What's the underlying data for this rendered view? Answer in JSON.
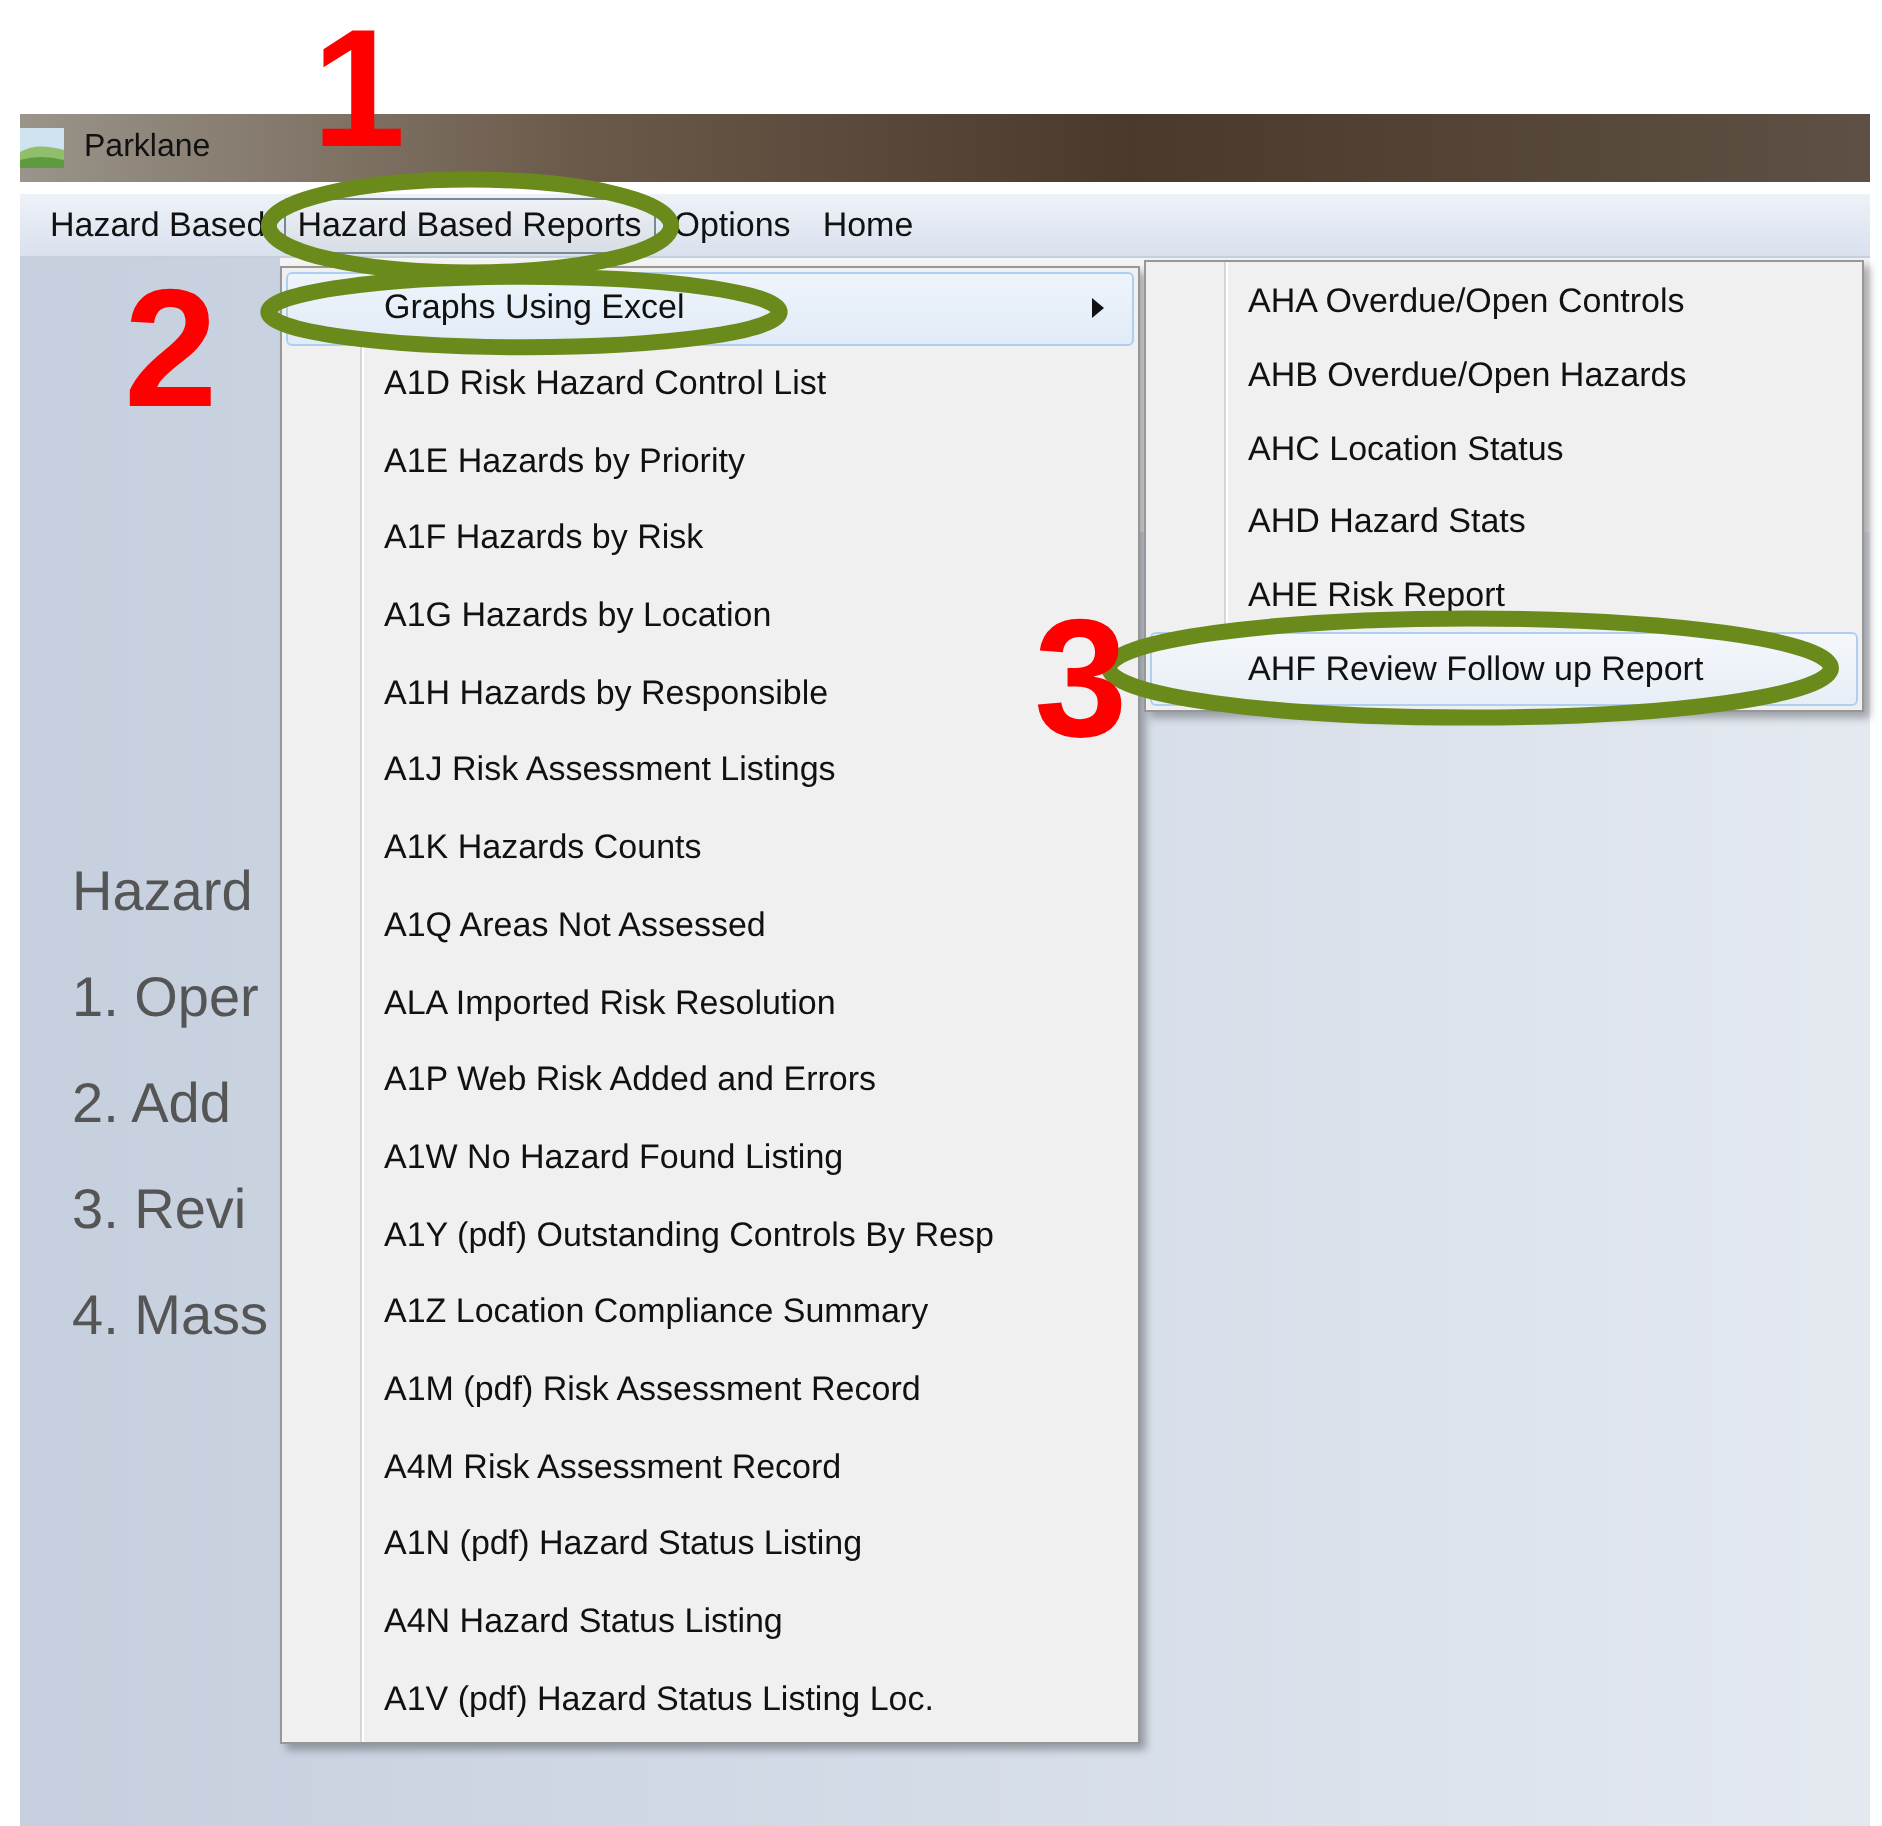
{
  "window": {
    "title": "Parklane"
  },
  "menu_bar": [
    {
      "label": "Hazard Based",
      "selected": false
    },
    {
      "label": "Hazard  Based Reports",
      "selected": true
    },
    {
      "label": "Options",
      "selected": false
    },
    {
      "label": "Home",
      "selected": false
    }
  ],
  "content": {
    "lines": [
      "Hazard",
      "1. Oper",
      "2. Add",
      "3. Revi",
      "4. Mass"
    ]
  },
  "dropdown": {
    "items": [
      {
        "label": "Graphs Using Excel",
        "has_submenu": true,
        "selected": true
      },
      {
        "label": "A1D Risk Hazard Control List",
        "has_submenu": false,
        "selected": false
      },
      {
        "label": "A1E Hazards by Priority",
        "has_submenu": false,
        "selected": false
      },
      {
        "label": "A1F  Hazards by Risk",
        "has_submenu": false,
        "selected": false
      },
      {
        "label": "A1G Hazards by Location",
        "has_submenu": false,
        "selected": false
      },
      {
        "label": "A1H Hazards by Responsible",
        "has_submenu": false,
        "selected": false
      },
      {
        "label": "A1J Risk Assessment Listings",
        "has_submenu": false,
        "selected": false
      },
      {
        "label": "A1K Hazards Counts",
        "has_submenu": false,
        "selected": false
      },
      {
        "label": "A1Q Areas Not Assessed",
        "has_submenu": false,
        "selected": false
      },
      {
        "label": "ALA Imported Risk Resolution",
        "has_submenu": false,
        "selected": false
      },
      {
        "label": "A1P Web Risk Added and Errors",
        "has_submenu": false,
        "selected": false
      },
      {
        "label": "A1W No Hazard Found Listing",
        "has_submenu": false,
        "selected": false
      },
      {
        "label": "A1Y (pdf) Outstanding Controls By Resp",
        "has_submenu": false,
        "selected": false
      },
      {
        "label": "A1Z Location Compliance Summary",
        "has_submenu": false,
        "selected": false
      },
      {
        "label": "A1M (pdf) Risk Assessment Record",
        "has_submenu": false,
        "selected": false
      },
      {
        "label": "A4M Risk Assessment Record",
        "has_submenu": false,
        "selected": false
      },
      {
        "label": "A1N (pdf) Hazard Status Listing",
        "has_submenu": false,
        "selected": false
      },
      {
        "label": "A4N Hazard Status Listing",
        "has_submenu": false,
        "selected": false
      },
      {
        "label": "A1V (pdf) Hazard Status Listing Loc.",
        "has_submenu": false,
        "selected": false
      }
    ]
  },
  "submenu": {
    "items": [
      {
        "label": "AHA Overdue/Open Controls",
        "selected": false
      },
      {
        "label": "AHB Overdue/Open Hazards",
        "selected": false
      },
      {
        "label": "AHC Location Status",
        "selected": false
      },
      {
        "label": "AHD Hazard Stats",
        "selected": false
      },
      {
        "label": "AHE Risk Report",
        "selected": false
      },
      {
        "label": "AHF Review Follow up Report",
        "selected": true
      }
    ]
  },
  "annotations": [
    {
      "number": "1"
    },
    {
      "number": "2"
    },
    {
      "number": "3"
    }
  ]
}
